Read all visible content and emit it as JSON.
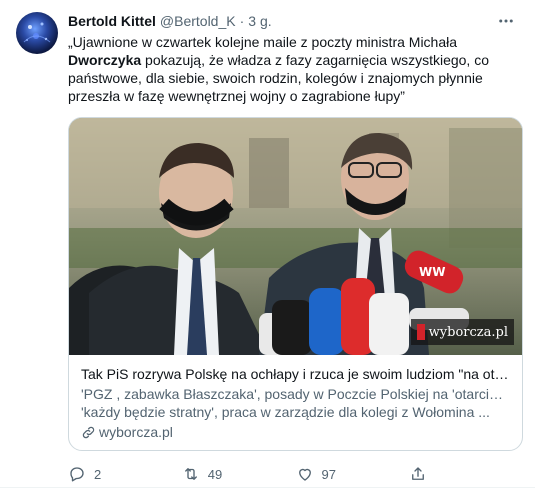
{
  "tweet": {
    "author_name": "Bertold Kittel",
    "author_handle": "@Bertold_K",
    "separator": "·",
    "time": "3 g.",
    "text_part1": "„Ujawnione w czwartek kolejne maile z poczty ministra Michała ",
    "text_bold": "Dworczyka",
    "text_part2": " pokazują, że władza z fazy zagarnięcia wszystkiego, co państwowe, dla siebie, swoich rodzin, kolegów i znajomych płynnie przeszła w fazę wewnętrznej wojny o zagrabione łupy”"
  },
  "card": {
    "title": "Tak PiS rozrywa Polskę na ochłapy i rzuca je swoim ludziom \"na otarci...",
    "description_line1": "'PGZ , zabawka Błaszczaka', posady w Poczcie Polskiej na 'otarcie łez',",
    "description_line2": "'każdy będzie stratny', praca w zarządzie dla kolegi z Wołomina ...",
    "domain": "wyborcza.pl",
    "watermark": "wyborcza.pl",
    "mic_label": "WW"
  },
  "actions": {
    "replies": "2",
    "retweets": "49",
    "likes": "97"
  },
  "icons": {
    "more": "more-icon",
    "link": "link-icon",
    "reply": "reply-icon",
    "retweet": "retweet-icon",
    "like": "like-icon",
    "share": "share-icon"
  },
  "colors": {
    "text": "#0f1419",
    "secondary": "#536471",
    "border": "#cfd9de",
    "watermark_red": "#d2232a"
  }
}
